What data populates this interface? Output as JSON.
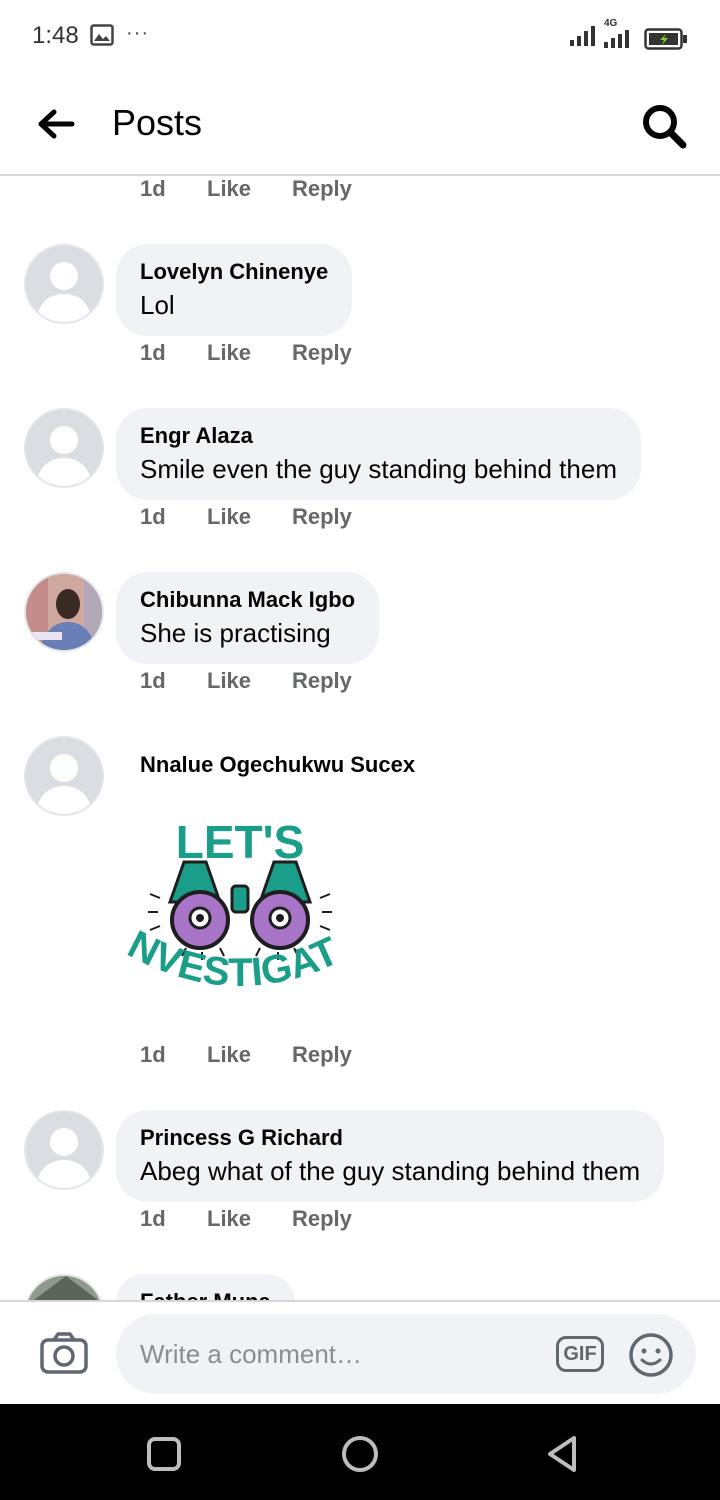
{
  "status_bar": {
    "time": "1:48",
    "overflow": "···",
    "network": "4G",
    "icons": [
      "gallery-icon",
      "signal-icon",
      "battery-charging-icon"
    ]
  },
  "header": {
    "title": "Posts",
    "back_icon": "arrow-left-icon",
    "search_icon": "search-icon"
  },
  "comments": [
    {
      "id": "prev",
      "author": "",
      "text": "",
      "time": "1d",
      "like": "Like",
      "reply": "Reply"
    },
    {
      "id": "c1",
      "author": "Lovelyn Chinenye",
      "text": "Lol",
      "time": "1d",
      "like": "Like",
      "reply": "Reply"
    },
    {
      "id": "c2",
      "author": "Engr Alaza",
      "text": "Smile  even the guy standing behind them",
      "time": "1d",
      "like": "Like",
      "reply": "Reply"
    },
    {
      "id": "c3",
      "author": "Chibunna Mack Igbo",
      "text": "She is practising",
      "time": "1d",
      "like": "Like",
      "reply": "Reply"
    },
    {
      "id": "c4",
      "author": "Nnalue Ogechukwu Sucex",
      "text": "",
      "sticker": "LET'S INVESTIGATE",
      "time": "1d",
      "like": "Like",
      "reply": "Reply"
    },
    {
      "id": "c5",
      "author": "Princess G Richard",
      "text": "Abeg what of the guy standing behind them",
      "time": "1d",
      "like": "Like",
      "reply": "Reply"
    },
    {
      "id": "c6",
      "author": "Father Muna",
      "text": ""
    }
  ],
  "sticker": {
    "line1": "LET'S",
    "line2": "INVESTIGATE",
    "colors": {
      "teal": "#1a9e8a",
      "purple": "#a874c8",
      "dark": "#1e1e1e"
    }
  },
  "composer": {
    "placeholder": "Write a comment…",
    "gif_label": "GIF",
    "icons": [
      "camera-icon",
      "emoji-icon"
    ]
  },
  "colors": {
    "bubble": "#f0f2f5",
    "secondary_text": "#65676b",
    "divider": "#d6d6d6"
  }
}
